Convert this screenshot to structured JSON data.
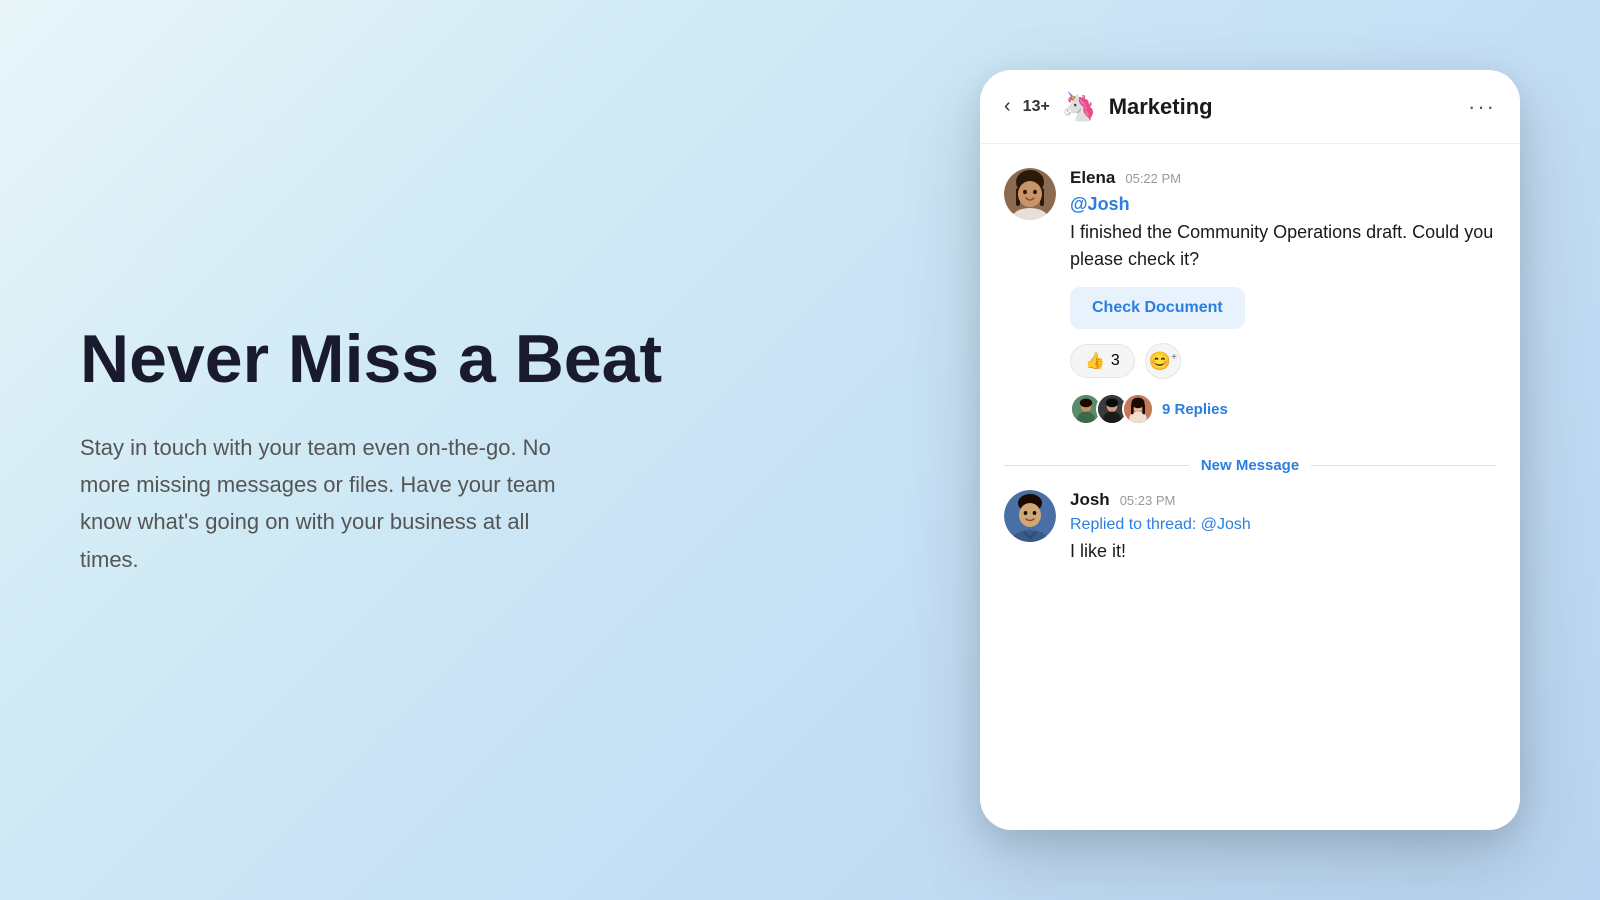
{
  "left": {
    "title": "Never Miss a Beat",
    "subtitle": "Stay in touch with your team even on-the-go. No more missing messages or files. Have your team know what's going on with your business at all times."
  },
  "chat": {
    "back_label": "‹",
    "member_count": "13+",
    "channel_emoji": "🦄",
    "channel_name": "Marketing",
    "more_button": "···",
    "messages": [
      {
        "sender": "Elena",
        "time": "05:22 PM",
        "mention": "@Josh",
        "text": "I finished the Community Operations draft. Could you please check it?",
        "button_label": "Check Document",
        "reaction_emoji": "👍",
        "reaction_count": "3",
        "replies_count": "9 Replies"
      },
      {
        "sender": "Josh",
        "time": "05:23 PM",
        "replied_to": "Replied to thread:",
        "replied_mention": "@Josh",
        "text": "I like it!"
      }
    ],
    "new_message_label": "New Message"
  }
}
